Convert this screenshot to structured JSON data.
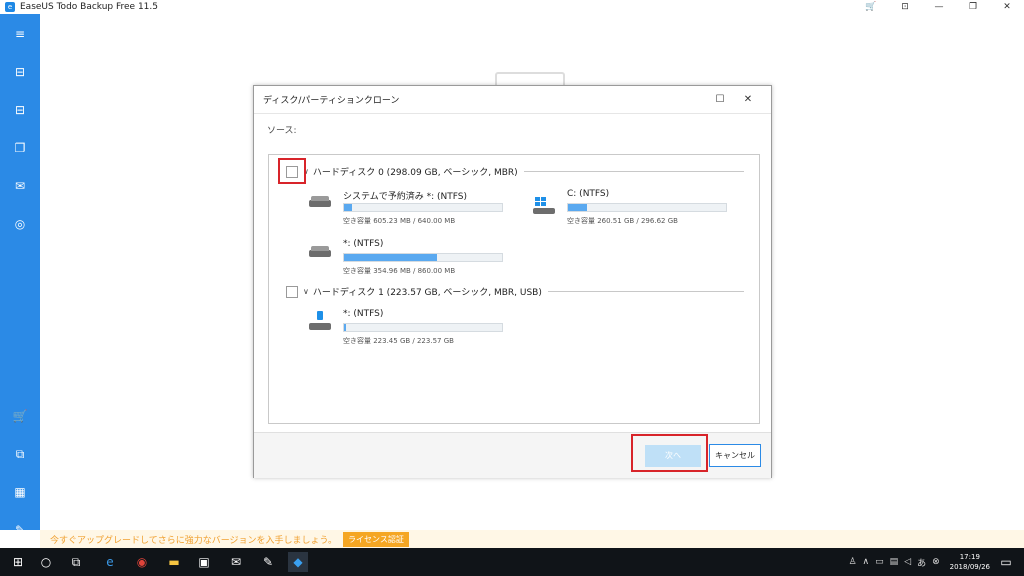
{
  "window": {
    "title": "EaseUS Todo Backup Free 11.5",
    "cart_icon": "cart-icon",
    "controls": [
      "⊡",
      "—",
      "❐",
      "✕"
    ]
  },
  "sidebar": {
    "items": [
      {
        "icon": "menu-icon",
        "glyph": "≡"
      },
      {
        "icon": "disk-backup-icon",
        "glyph": "⊟"
      },
      {
        "icon": "system-backup-icon",
        "glyph": "⊟"
      },
      {
        "icon": "file-backup-icon",
        "glyph": "❐"
      },
      {
        "icon": "mail-backup-icon",
        "glyph": "✉"
      },
      {
        "icon": "smart-backup-icon",
        "glyph": "◎"
      },
      {
        "icon": "cart-icon",
        "glyph": "🛒"
      },
      {
        "icon": "clone-icon",
        "glyph": "⧉"
      },
      {
        "icon": "apps-icon",
        "glyph": "▦"
      },
      {
        "icon": "tools-icon",
        "glyph": "✎"
      }
    ]
  },
  "dialog": {
    "title": "ディスク/パーティションクローン",
    "source_label": "ソース:",
    "disks": [
      {
        "name": "ハードディスク 0 (298.09 GB, ベーシック, MBR)",
        "partitions": [
          {
            "name": "システムで予約済み *: (NTFS)",
            "info": "空き容量 605.23 MB / 640.00 MB",
            "used": 0.05,
            "icon": "hdd-icon"
          },
          {
            "name": "C: (NTFS)",
            "info": "空き容量 260.51 GB / 296.62 GB",
            "used": 0.12,
            "icon": "windows-drive-icon"
          },
          {
            "name": "*: (NTFS)",
            "info": "空き容量 354.96 MB / 860.00 MB",
            "used": 0.59,
            "icon": "hdd-icon"
          }
        ]
      },
      {
        "name": "ハードディスク 1 (223.57 GB, ベーシック, MBR, USB)",
        "partitions": [
          {
            "name": "*: (NTFS)",
            "info": "空き容量 223.45 GB / 223.57 GB",
            "used": 0.01,
            "icon": "usb-drive-icon"
          }
        ]
      }
    ],
    "next_label": "次へ",
    "cancel_label": "キャンセル"
  },
  "upgrade_bar": {
    "message": "今すぐアップグレードしてさらに強力なバージョンを入手しましょう。",
    "license_button": "ライセンス認証"
  },
  "taskbar": {
    "time": "17:19",
    "date": "2018/09/26"
  }
}
